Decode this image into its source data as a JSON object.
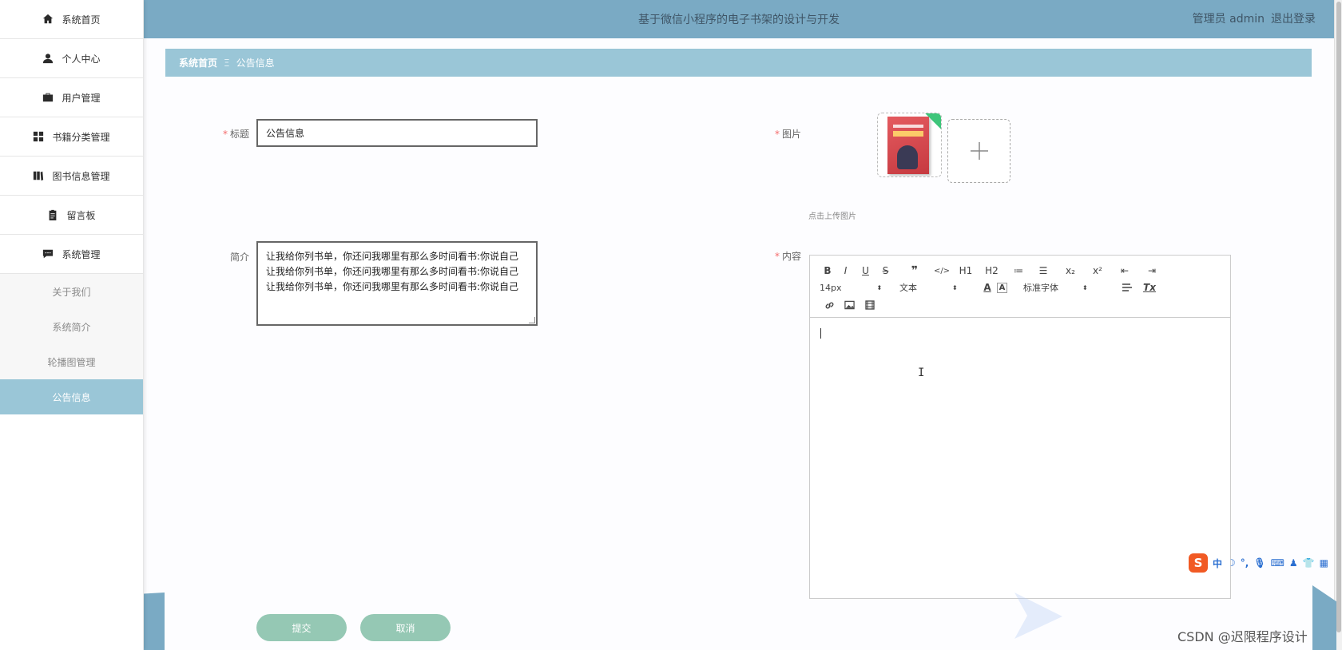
{
  "app": {
    "title": "基于微信小程序的电子书架的设计与开发",
    "user_role": "管理员 admin",
    "logout": "退出登录"
  },
  "sidebar": {
    "items": [
      {
        "label": "系统首页",
        "icon": "home-icon"
      },
      {
        "label": "个人中心",
        "icon": "person-icon"
      },
      {
        "label": "用户管理",
        "icon": "briefcase-icon"
      },
      {
        "label": "书籍分类管理",
        "icon": "grid-icon"
      },
      {
        "label": "图书信息管理",
        "icon": "books-icon"
      },
      {
        "label": "留言板",
        "icon": "clipboard-icon"
      },
      {
        "label": "系统管理",
        "icon": "chat-icon"
      }
    ],
    "sub_items": [
      {
        "label": "关于我们",
        "active": false
      },
      {
        "label": "系统简介",
        "active": false
      },
      {
        "label": "轮播图管理",
        "active": false
      },
      {
        "label": "公告信息",
        "active": true
      }
    ]
  },
  "breadcrumb": {
    "home": "系统首页",
    "separator": "Ξ",
    "current": "公告信息"
  },
  "form": {
    "title_label": "标题",
    "title_value": "公告信息",
    "intro_label": "简介",
    "intro_lines": [
      "让我给你列书单，你还问我哪里有那么多时间看书:你说自己",
      "让我给你列书单，你还问我哪里有那么多时间看书:你说自己",
      "让我给你列书单，你还问我哪里有那么多时间看书:你说自己"
    ],
    "image_label": "图片",
    "upload_tip": "点击上传图片",
    "content_label": "内容",
    "required_mark": "*"
  },
  "editor": {
    "row1": [
      "B",
      "I",
      "U",
      "S",
      "❞",
      "</>",
      "H1",
      "H2",
      "≔",
      "☰",
      "x₂",
      "x²",
      "⇤",
      "⇥"
    ],
    "font_size": "14px",
    "text_type": "文本",
    "font_family": "标准字体",
    "color_a": "A",
    "bg_a": "A",
    "clear": "Tx"
  },
  "buttons": {
    "submit": "提交",
    "cancel": "取消"
  },
  "ime": {
    "logo": "S",
    "lang": "中"
  },
  "watermark": "CSDN @迟限程序设计",
  "colors": {
    "header": "#7aaac4",
    "breadcrumb": "#9ac6d7",
    "button": "#95c8b4",
    "active_menu": "#9ac6d7",
    "required": "#f56c6c"
  }
}
